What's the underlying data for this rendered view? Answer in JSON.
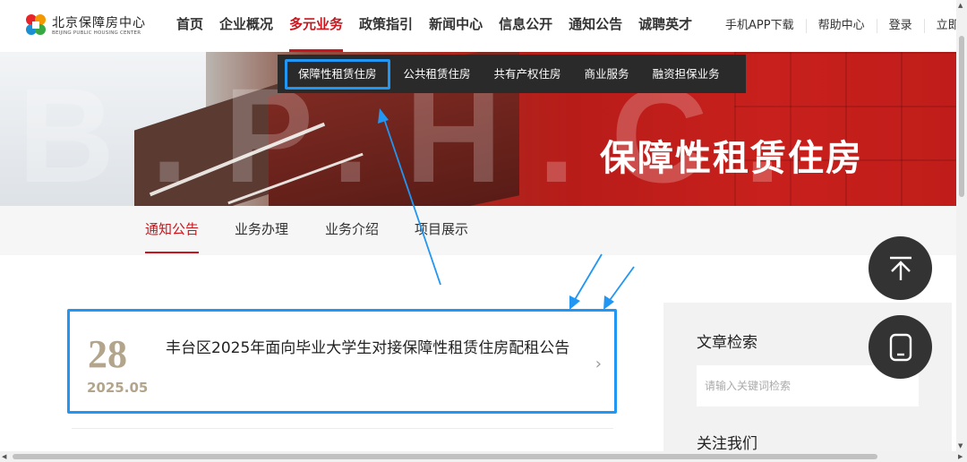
{
  "brand": {
    "name": "北京保障房中心",
    "subtitle": "BEIJING PUBLIC HOUSING CENTER",
    "colors": {
      "accent": "#c8161e",
      "highlight": "#2196f3",
      "gold": "#b3a58b"
    }
  },
  "nav": {
    "items": [
      {
        "label": "首页"
      },
      {
        "label": "企业概况"
      },
      {
        "label": "多元业务"
      },
      {
        "label": "政策指引"
      },
      {
        "label": "新闻中心"
      },
      {
        "label": "信息公开"
      },
      {
        "label": "通知公告"
      },
      {
        "label": "诚聘英才"
      }
    ],
    "active": "多元业务"
  },
  "top_links": [
    {
      "label": "手机APP下载"
    },
    {
      "label": "帮助中心"
    },
    {
      "label": "登录"
    },
    {
      "label": "立即注"
    }
  ],
  "submenu": {
    "items": [
      {
        "label": "保障性租赁住房"
      },
      {
        "label": "公共租赁住房"
      },
      {
        "label": "共有产权住房"
      },
      {
        "label": "商业服务"
      },
      {
        "label": "融资担保业务"
      }
    ],
    "active": "保障性租赁住房"
  },
  "banner": {
    "title": "保障性租赁住房",
    "watermark": "B.P.H.C."
  },
  "tabs": [
    {
      "label": "通知公告"
    },
    {
      "label": "业务办理"
    },
    {
      "label": "业务介绍"
    },
    {
      "label": "项目展示"
    }
  ],
  "notices": [
    {
      "day": "28",
      "year_month": "2025.05",
      "title": "丰台区2025年面向毕业大学生对接保障性租赁住房配租公告"
    }
  ],
  "sidebar": {
    "search_title": "文章检索",
    "search_placeholder": "请输入关键词检索",
    "follow_title": "关注我们"
  },
  "floating": {
    "icons": [
      "arrow-up-icon",
      "tablet-icon"
    ]
  }
}
